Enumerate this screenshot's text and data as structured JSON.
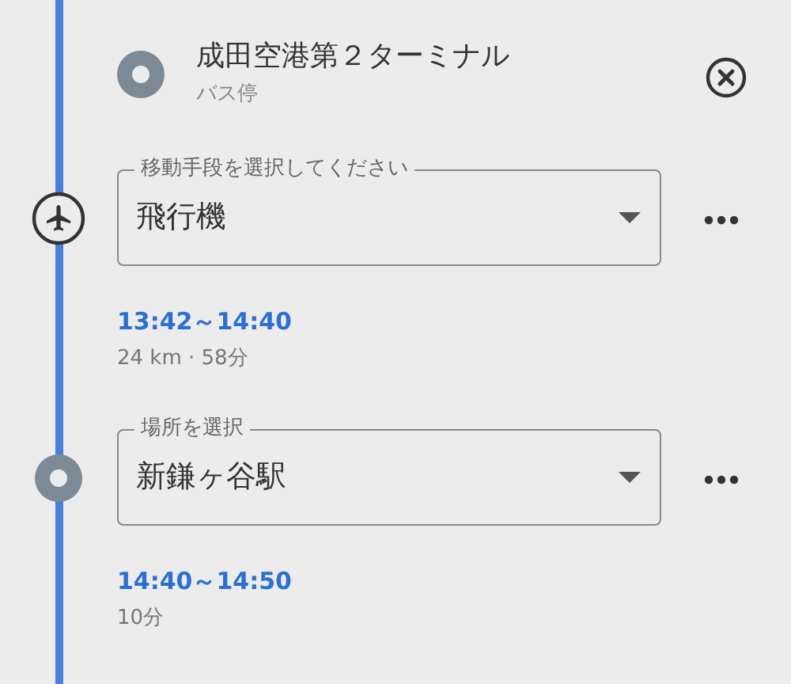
{
  "stop": {
    "name": "成田空港第２ターミナル",
    "type": "バス停"
  },
  "segments": [
    {
      "kind": "mode",
      "field": {
        "label": "移動手段を選択してください",
        "value": "飛行機"
      },
      "time": "13:42～14:40",
      "detail": "24 km · 58分"
    },
    {
      "kind": "place",
      "field": {
        "label": "場所を選択",
        "value": "新鎌ヶ谷駅"
      },
      "time": "14:40～14:50",
      "detail": "10分"
    }
  ]
}
